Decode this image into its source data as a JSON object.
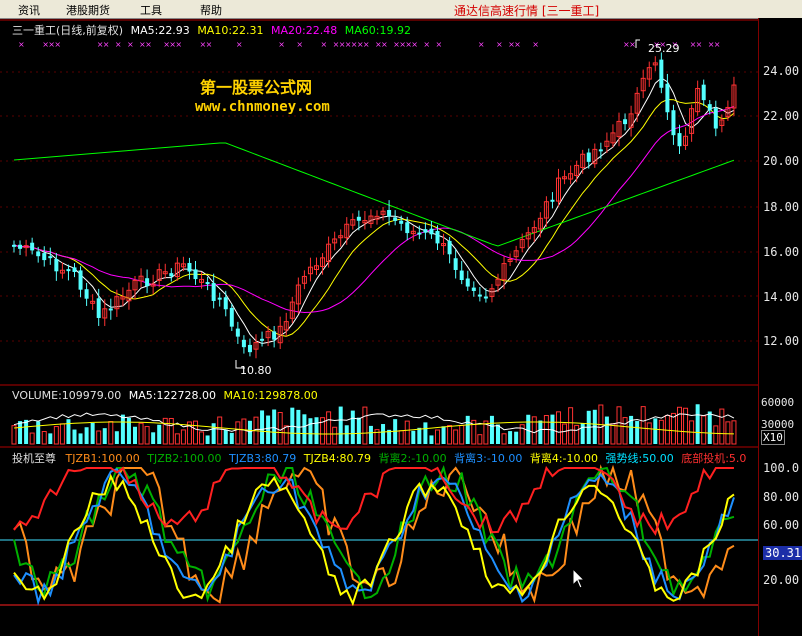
{
  "menu": {
    "items": [
      "资讯",
      "港股期货",
      "工具",
      "帮助"
    ],
    "title": "通达信高速行情 [三一重工]"
  },
  "price_panel": {
    "stock_label": "三一重工(日线,前复权)",
    "ma5": "MA5:22.93",
    "ma10": "MA10:22.31",
    "ma20": "MA20:22.48",
    "ma60": "MA60:19.92",
    "high_label": "25.29",
    "low_label": "10.80",
    "watermark_title": "第一股票公式网",
    "watermark_url": "www.chnmoney.com",
    "y_ticks": [
      "24.00",
      "22.00",
      "20.00",
      "18.00",
      "16.00",
      "14.00",
      "12.00"
    ]
  },
  "volume_panel": {
    "volume": "VOLUME:109979.00",
    "ma5": "MA5:122728.00",
    "ma10": "MA10:129878.00",
    "y_ticks": [
      "60000",
      "30000"
    ],
    "multiplier": "X10"
  },
  "indicator_panel": {
    "name": "投机至尊",
    "tjzb1": "TJZB1:100.00",
    "tjzb2": "TJZB2:100.00",
    "tjzb3": "TJZB3:80.79",
    "tjzb4": "TJZB4:80.79",
    "bl2": "背离2:-10.00",
    "bl3": "背离3:-10.00",
    "bl4": "背离4:-10.00",
    "qsx": "强势线:50.00",
    "dbtj": "底部投机:5.0",
    "y_ticks": [
      "100.0",
      "80.00",
      "60.00",
      "40.00",
      "20.00"
    ],
    "current_value": "30.31"
  },
  "colors": {
    "up": "#ff3232",
    "down": "#54ffff",
    "ma5": "#ffffff",
    "ma10": "#ffff00",
    "ma20": "#ff00ff",
    "ma60": "#00ff00"
  },
  "chart_data": [
    {
      "type": "line",
      "title": "三一重工(日线,前复权)",
      "series": [
        {
          "name": "MA5",
          "last": 22.93
        },
        {
          "name": "MA10",
          "last": 22.31
        },
        {
          "name": "MA20",
          "last": 22.48
        },
        {
          "name": "MA60",
          "last": 19.92
        }
      ],
      "annotations": {
        "high": 25.29,
        "low": 10.8
      },
      "ylim": [
        11,
        25
      ]
    },
    {
      "type": "bar",
      "title": "VOLUME",
      "series": [
        {
          "name": "VOLUME",
          "last": 109979.0
        },
        {
          "name": "MA5",
          "last": 122728.0
        },
        {
          "name": "MA10",
          "last": 129878.0
        }
      ]
    },
    {
      "type": "line",
      "title": "投机至尊",
      "series": [
        {
          "name": "TJZB1",
          "last": 100.0
        },
        {
          "name": "TJZB2",
          "last": 100.0
        },
        {
          "name": "TJZB3",
          "last": 80.79
        },
        {
          "name": "TJZB4",
          "last": 80.79
        },
        {
          "name": "背离2",
          "last": -10.0
        },
        {
          "name": "背离3",
          "last": -10.0
        },
        {
          "name": "背离4",
          "last": -10.0
        },
        {
          "name": "强势线",
          "last": 50.0
        },
        {
          "name": "底部投机",
          "last": 5.0
        }
      ],
      "ylim": [
        0,
        100
      ]
    }
  ]
}
